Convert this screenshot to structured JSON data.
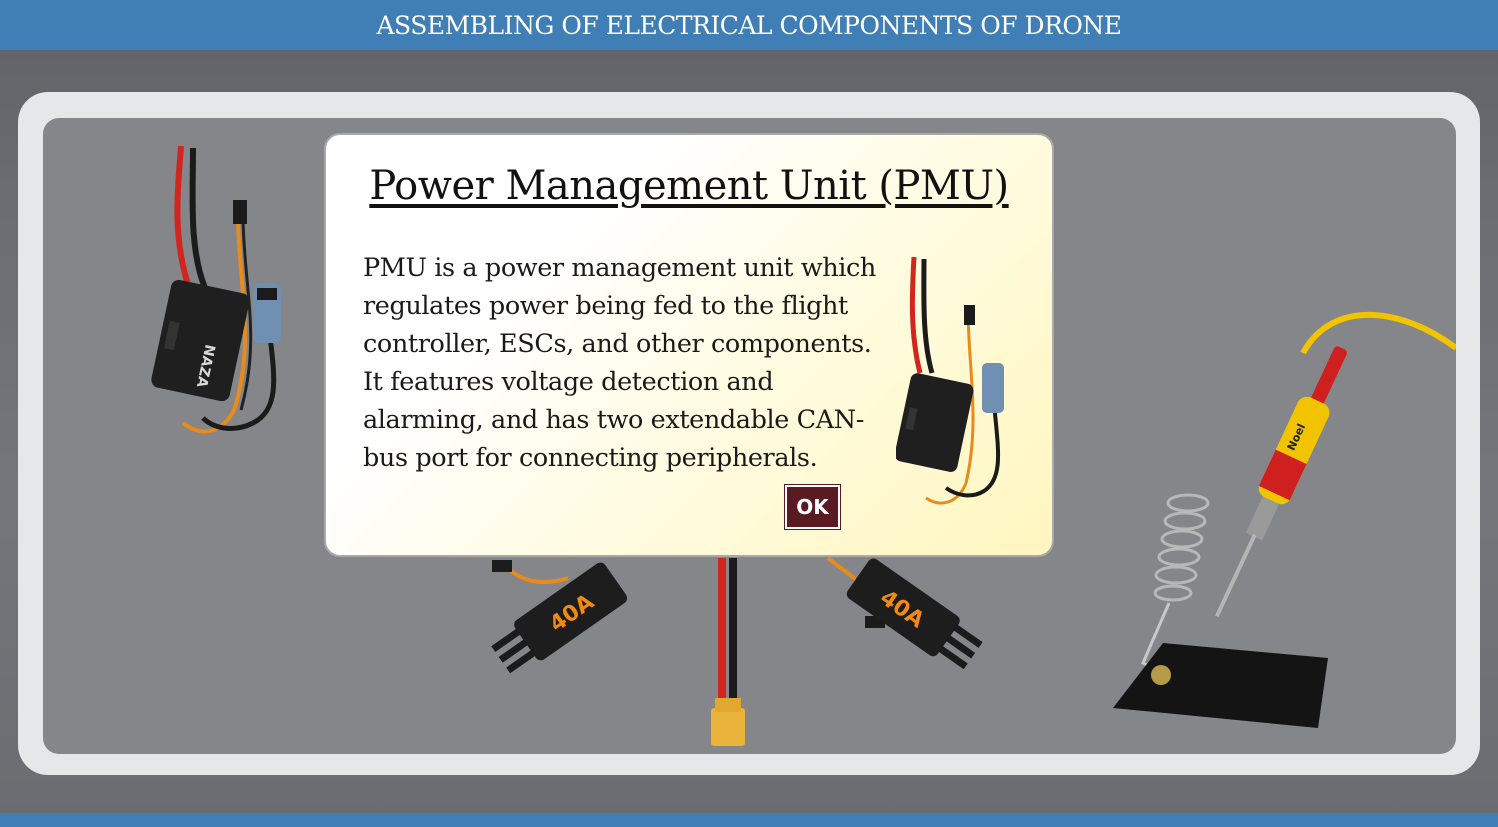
{
  "header": {
    "title": "ASSEMBLING OF ELECTRICAL COMPONENTS OF DRONE"
  },
  "modal": {
    "title": "Power Management Unit (PMU)",
    "body": "PMU is a power management unit which regulates power being fed to the flight controller, ESCs, and other components. It features voltage detection and alarming, and has two extendable CAN-bus port for connecting peripherals.",
    "ok_label": "OK"
  },
  "components": {
    "pmu_label": "NAZA",
    "esc_label": "40A",
    "iron_label": "Noel"
  }
}
